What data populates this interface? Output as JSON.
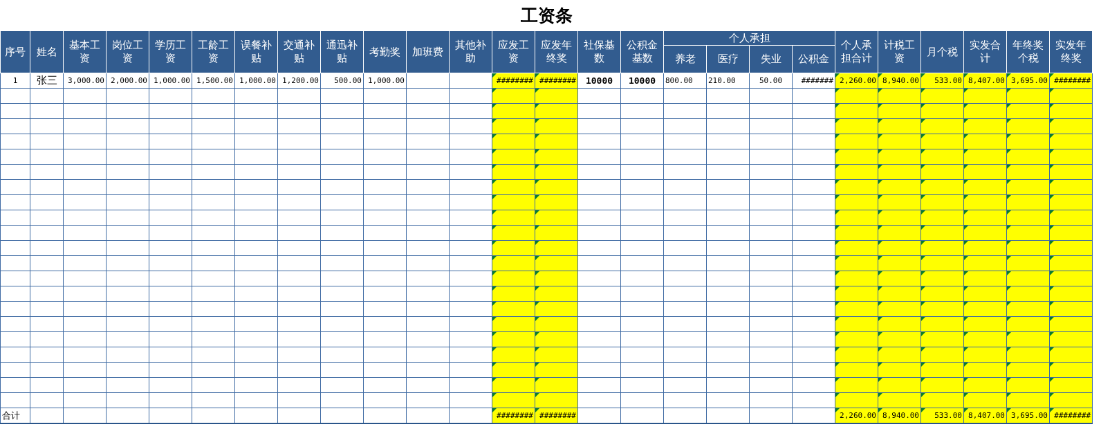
{
  "title": "工资条",
  "columns": [
    {
      "label": "序号"
    },
    {
      "label": "姓名"
    },
    {
      "label": "基本工资"
    },
    {
      "label": "岗位工资"
    },
    {
      "label": "学历工资"
    },
    {
      "label": "工龄工资"
    },
    {
      "label": "误餐补贴"
    },
    {
      "label": "交通补贴"
    },
    {
      "label": "通迅补贴"
    },
    {
      "label": "考勤奖"
    },
    {
      "label": "加班费"
    },
    {
      "label": "其他补助"
    },
    {
      "label": "应发工资",
      "highlighted": true
    },
    {
      "label": "应发年终奖",
      "highlighted": true
    },
    {
      "label": "社保基数",
      "bold": true
    },
    {
      "label": "公积金基数",
      "bold": true
    },
    {
      "kind": "group",
      "label": "个人承担",
      "children": [
        {
          "label": "养老"
        },
        {
          "label": "医疗"
        },
        {
          "label": "失业"
        },
        {
          "label": "公积金"
        }
      ]
    },
    {
      "label": "个人承担合计",
      "highlighted": true
    },
    {
      "label": "计税工资",
      "highlighted": true
    },
    {
      "label": "月个税",
      "highlighted": true
    },
    {
      "label": "实发合计",
      "highlighted": true
    },
    {
      "label": "年终奖个税",
      "highlighted": true
    },
    {
      "label": "实发年终奖",
      "highlighted": true
    }
  ],
  "rows": [
    {
      "cells": [
        "1",
        "张三",
        "3,000.00",
        "2,000.00",
        "1,000.00",
        "1,500.00",
        "1,000.00",
        "1,200.00",
        "500.00",
        "1,000.00",
        null,
        null,
        "########",
        "########",
        "10000",
        "10000",
        "800.00",
        "210.00",
        "50.00",
        "#######",
        "2,260.00",
        "8,940.00",
        "533.00",
        "8,407.00",
        "3,695.00",
        "########"
      ]
    }
  ],
  "total_row": {
    "cells": [
      "合计",
      null,
      null,
      null,
      null,
      null,
      null,
      null,
      null,
      null,
      null,
      null,
      "########",
      "########",
      null,
      null,
      null,
      null,
      null,
      null,
      "2,260.00",
      "8,940.00",
      "533.00",
      "8,407.00",
      "3,695.00",
      "########"
    ]
  }
}
